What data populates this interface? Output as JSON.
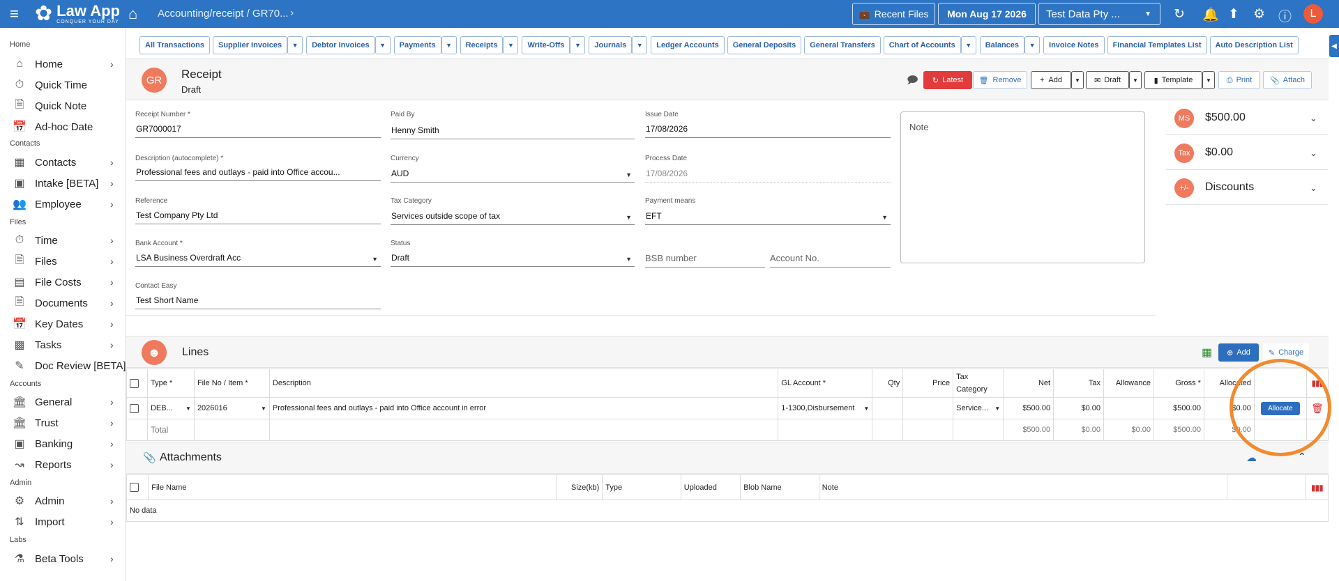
{
  "topbar": {
    "logo_name": "Law App",
    "logo_tagline": "CONQUER YOUR DAY",
    "breadcrumb": "Accounting/receipt / GR70...",
    "recent_files_label": "Recent Files",
    "date_label": "Mon Aug 17 2026",
    "org_selector": "Test Data Pty ...",
    "avatar_initial": "L"
  },
  "sidebar": {
    "sections": [
      {
        "heading": "Home",
        "items": [
          {
            "label": "Home",
            "icon": "home-icon",
            "chevron": true
          },
          {
            "label": "Quick Time",
            "icon": "timer-icon",
            "chevron": false
          },
          {
            "label": "Quick Note",
            "icon": "note-icon",
            "chevron": false
          },
          {
            "label": "Ad-hoc Date",
            "icon": "calendar-icon",
            "chevron": false
          }
        ]
      },
      {
        "heading": "Contacts",
        "items": [
          {
            "label": "Contacts",
            "icon": "contacts-icon",
            "chevron": true
          },
          {
            "label": "Intake [BETA]",
            "icon": "intake-icon",
            "chevron": true
          },
          {
            "label": "Employee",
            "icon": "employee-icon",
            "chevron": true
          }
        ]
      },
      {
        "heading": "Files",
        "items": [
          {
            "label": "Time",
            "icon": "timer-icon",
            "chevron": true
          },
          {
            "label": "Files",
            "icon": "file-icon",
            "chevron": true
          },
          {
            "label": "File Costs",
            "icon": "cost-icon",
            "chevron": true
          },
          {
            "label": "Documents",
            "icon": "document-icon",
            "chevron": true
          },
          {
            "label": "Key Dates",
            "icon": "calendar-icon",
            "chevron": true
          },
          {
            "label": "Tasks",
            "icon": "tasks-icon",
            "chevron": true
          },
          {
            "label": "Doc Review [BETA]",
            "icon": "review-icon",
            "chevron": false
          }
        ]
      },
      {
        "heading": "Accounts",
        "items": [
          {
            "label": "General",
            "icon": "bank-icon",
            "chevron": true
          },
          {
            "label": "Trust",
            "icon": "bank-icon",
            "chevron": true
          },
          {
            "label": "Banking",
            "icon": "banking-icon",
            "chevron": true
          },
          {
            "label": "Reports",
            "icon": "reports-icon",
            "chevron": true
          }
        ]
      },
      {
        "heading": "Admin",
        "items": [
          {
            "label": "Admin",
            "icon": "admin-icon",
            "chevron": true
          },
          {
            "label": "Import",
            "icon": "import-icon",
            "chevron": true
          }
        ]
      },
      {
        "heading": "Labs",
        "items": [
          {
            "label": "Beta Tools",
            "icon": "flask-icon",
            "chevron": true
          }
        ]
      }
    ]
  },
  "tabs": [
    {
      "label": "All Transactions",
      "dropdown": false
    },
    {
      "label": "Supplier Invoices",
      "dropdown": true
    },
    {
      "label": "Debtor Invoices",
      "dropdown": true
    },
    {
      "label": "Payments",
      "dropdown": true
    },
    {
      "label": "Receipts",
      "dropdown": true
    },
    {
      "label": "Write-Offs",
      "dropdown": true
    },
    {
      "label": "Journals",
      "dropdown": true
    },
    {
      "label": "Ledger Accounts",
      "dropdown": false
    },
    {
      "label": "General Deposits",
      "dropdown": false
    },
    {
      "label": "General Transfers",
      "dropdown": false
    },
    {
      "label": "Chart of Accounts",
      "dropdown": true
    },
    {
      "label": "Balances",
      "dropdown": true
    },
    {
      "label": "Invoice Notes",
      "dropdown": false
    },
    {
      "label": "Financial Templates List",
      "dropdown": false
    },
    {
      "label": "Auto Description List",
      "dropdown": false
    }
  ],
  "header": {
    "avatar": "GR",
    "title": "Receipt",
    "status": "Draft",
    "buttons": {
      "latest": "Latest",
      "remove": "Remove",
      "add": "Add",
      "draft": "Draft",
      "template": "Template",
      "print": "Print",
      "attach": "Attach"
    }
  },
  "form": {
    "receipt_number": {
      "label": "Receipt Number *",
      "value": "GR7000017"
    },
    "paid_by": {
      "label": "Paid By",
      "value": "Henny Smith"
    },
    "issue_date": {
      "label": "Issue Date",
      "value": "17/08/2026"
    },
    "description": {
      "label": "Description (autocomplete) *",
      "value": "Professional fees and outlays - paid into Office accou..."
    },
    "currency": {
      "label": "Currency",
      "value": "AUD"
    },
    "process_date": {
      "label": "Process Date",
      "value": "17/08/2026"
    },
    "reference": {
      "label": "Reference",
      "value": "Test Company Pty Ltd"
    },
    "tax_category": {
      "label": "Tax Category",
      "value": "Services outside scope of tax"
    },
    "payment_means": {
      "label": "Payment means",
      "value": "EFT"
    },
    "bank_account": {
      "label": "Bank Account *",
      "value": "LSA Business Overdraft Acc"
    },
    "status": {
      "label": "Status",
      "value": "Draft"
    },
    "bsb_placeholder": "BSB number",
    "account_placeholder": "Account No.",
    "contact_easy": {
      "label": "Contact Easy",
      "value": "Test Short Name"
    },
    "note_label": "Note"
  },
  "summary": [
    {
      "icon_text": "MS",
      "value": "$500.00"
    },
    {
      "icon_text": "Tax",
      "value": "$0.00"
    },
    {
      "icon_text": "+/-",
      "value": "Discounts"
    }
  ],
  "lines": {
    "title": "Lines",
    "add_label": "Add",
    "charge_label": "Charge",
    "columns": [
      "Type *",
      "File No / Item *",
      "Description",
      "GL Account *",
      "Qty",
      "Price",
      "Tax Category",
      "Net",
      "Tax",
      "Allowance",
      "Gross *",
      "Allocated"
    ],
    "row": {
      "type": "DEB...",
      "file_no": "2026016",
      "description": "Professional fees and outlays - paid into Office account in error",
      "gl_account": "1-1300,Disbursement",
      "qty": "",
      "price": "",
      "tax_category": "Service...",
      "net": "$500.00",
      "tax": "$0.00",
      "allowance": "",
      "gross": "$500.00",
      "allocated": "$0.00",
      "allocate_label": "Allocate"
    },
    "total": {
      "label": "Total",
      "net": "$500.00",
      "tax": "$0.00",
      "allowance": "$0.00",
      "gross": "$500.00",
      "allocated": "$0.00"
    }
  },
  "attachments": {
    "title": "Attachments",
    "columns": [
      "File Name",
      "Size(kb)",
      "Type",
      "Uploaded",
      "Blob Name",
      "Note"
    ],
    "empty_text": "No data"
  },
  "colors": {
    "topbar": "#2d74c4",
    "accent_avatar": "#ef7a5d",
    "danger": "#e23b3b",
    "highlight_ring": "#f28a2e"
  }
}
